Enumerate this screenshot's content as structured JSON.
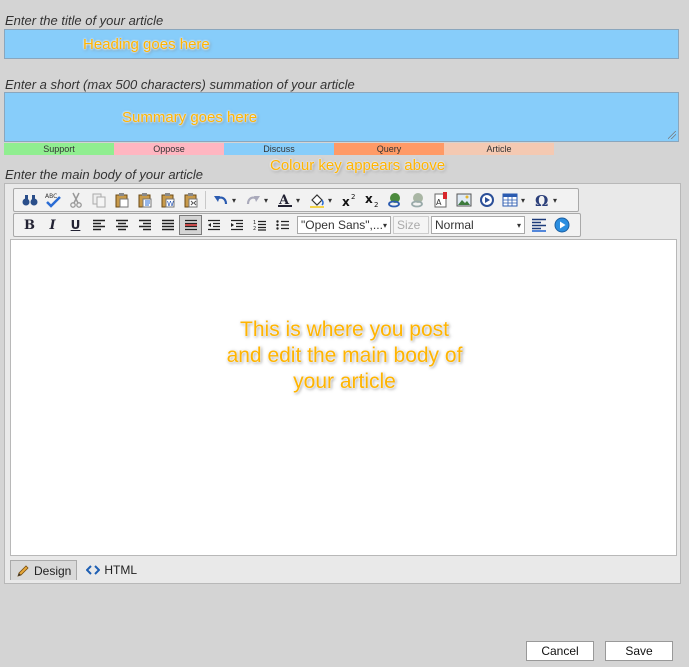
{
  "form": {
    "title_label": "Enter the title of your article",
    "title_value": "Heading goes here",
    "summary_label": "Enter a short (max 500 characters) summation of your article",
    "summary_value": "Summary goes here",
    "body_label": "Enter the main body of your article"
  },
  "color_key": [
    {
      "label": "Support",
      "color": "#90ee90"
    },
    {
      "label": "Oppose",
      "color": "#ffb6c1"
    },
    {
      "label": "Discuss",
      "color": "#87cdfa"
    },
    {
      "label": "Query",
      "color": "#ff9a66"
    },
    {
      "label": "Article",
      "color": "#f4c9b2"
    }
  ],
  "annotations": {
    "color_key_note": "Colour key appears above",
    "body_note_lines": [
      "This is where you post",
      "and edit the main body of",
      "your article"
    ]
  },
  "editor": {
    "toolbar1_icons": [
      "find-icon",
      "spellcheck-icon",
      "cut-icon",
      "copy-icon",
      "paste-icon",
      "paste-text-icon",
      "paste-word-icon",
      "paste-html-icon",
      "undo-icon",
      "redo-icon",
      "font-color-icon",
      "highlight-icon",
      "superscript-icon",
      "subscript-icon",
      "link-icon",
      "unlink-icon",
      "image-manager-icon",
      "insert-image-icon",
      "media-icon",
      "table-icon",
      "special-char-icon"
    ],
    "toolbar2_icons": [
      "bold-icon",
      "italic-icon",
      "underline-icon",
      "align-left-icon",
      "align-center-icon",
      "align-right-icon",
      "justify-icon",
      "strikethrough-icon",
      "outdent-icon",
      "indent-icon",
      "numbered-list-icon",
      "bulleted-list-icon"
    ],
    "font_family": "\"Open Sans\",...",
    "font_size_placeholder": "Size",
    "paragraph_style": "Normal",
    "modes": {
      "design": "Design",
      "html": "HTML"
    }
  },
  "actions": {
    "cancel": "Cancel",
    "save": "Save"
  }
}
